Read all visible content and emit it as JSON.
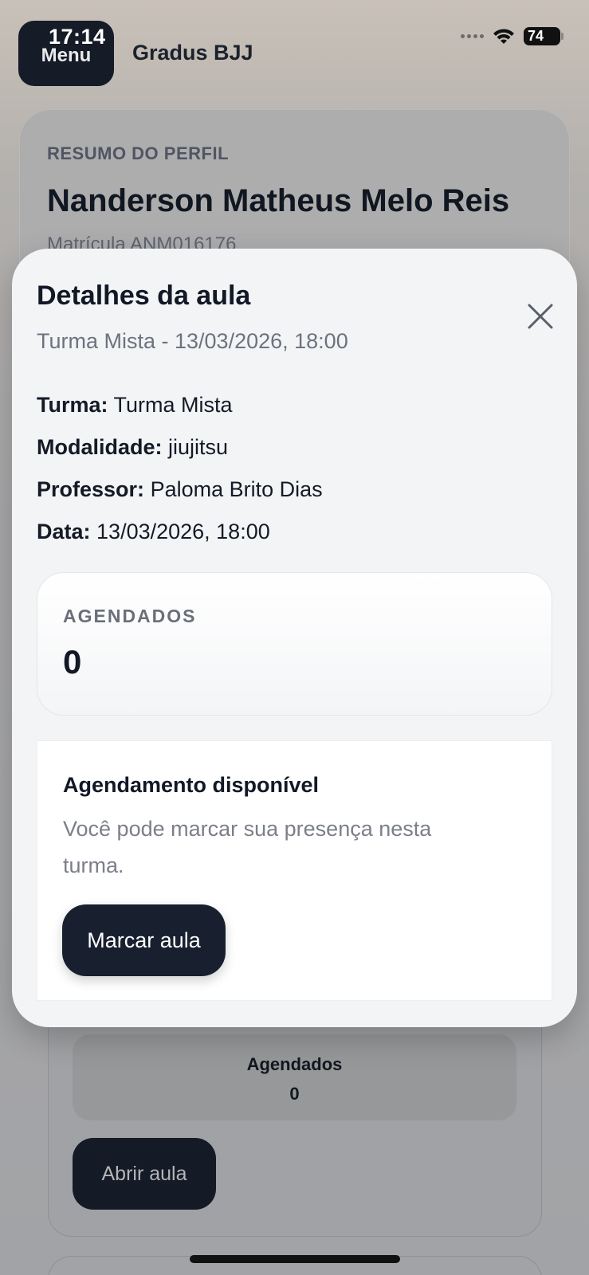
{
  "status_bar": {
    "time": "17:14",
    "battery": "74"
  },
  "header": {
    "menu_label": "Menu",
    "app_title": "Gradus BJJ"
  },
  "profile": {
    "kicker": "RESUMO DO PERFIL",
    "name": "Nanderson Matheus Melo Reis",
    "registration": "Matrícula ANM016176"
  },
  "background_class": {
    "scheduled_label": "Agendados",
    "scheduled_count": "0",
    "open_button": "Abrir aula"
  },
  "modal": {
    "title": "Detalhes da aula",
    "subtitle": "Turma Mista - 13/03/2026, 18:00",
    "details": [
      {
        "label": "Turma:",
        "value": "Turma Mista"
      },
      {
        "label": "Modalidade:",
        "value": "jiujitsu"
      },
      {
        "label": "Professor:",
        "value": "Paloma Brito Dias"
      },
      {
        "label": "Data:",
        "value": "13/03/2026, 18:00"
      }
    ],
    "stat": {
      "label": "AGENDADOS",
      "value": "0"
    },
    "availability": {
      "title": "Agendamento disponível",
      "text": "Você pode marcar sua presença nesta turma.",
      "button": "Marcar aula"
    }
  }
}
